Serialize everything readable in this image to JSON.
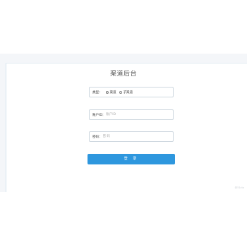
{
  "panel": {
    "title": "渠道后台"
  },
  "form": {
    "type_label": "类型：",
    "type_options": [
      {
        "label": "渠道",
        "checked": true
      },
      {
        "label": "子渠道",
        "checked": false
      }
    ],
    "account_label": "账户ID：",
    "account_placeholder": "账户ID",
    "password_label": "密码：",
    "password_placeholder": "密 码",
    "login_label": "登 录"
  },
  "watermark": {
    "text": "@51cto"
  },
  "colors": {
    "button": "#2e97de",
    "background": "#f4f6f9"
  }
}
